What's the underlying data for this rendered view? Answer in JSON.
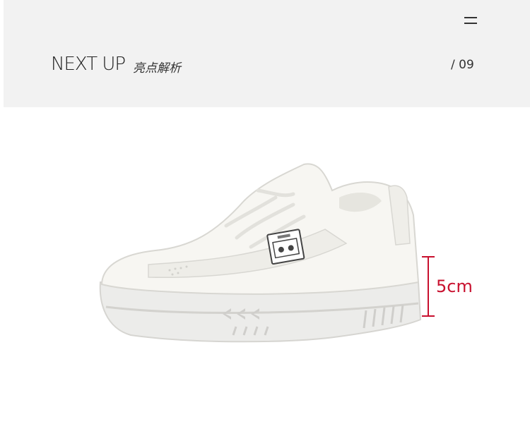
{
  "header": {
    "title": "NEXT UP",
    "subtitle": "亮点解析",
    "page_number": "/ 09"
  },
  "product": {
    "height_label": "5cm",
    "accent_color": "#c8102e"
  }
}
